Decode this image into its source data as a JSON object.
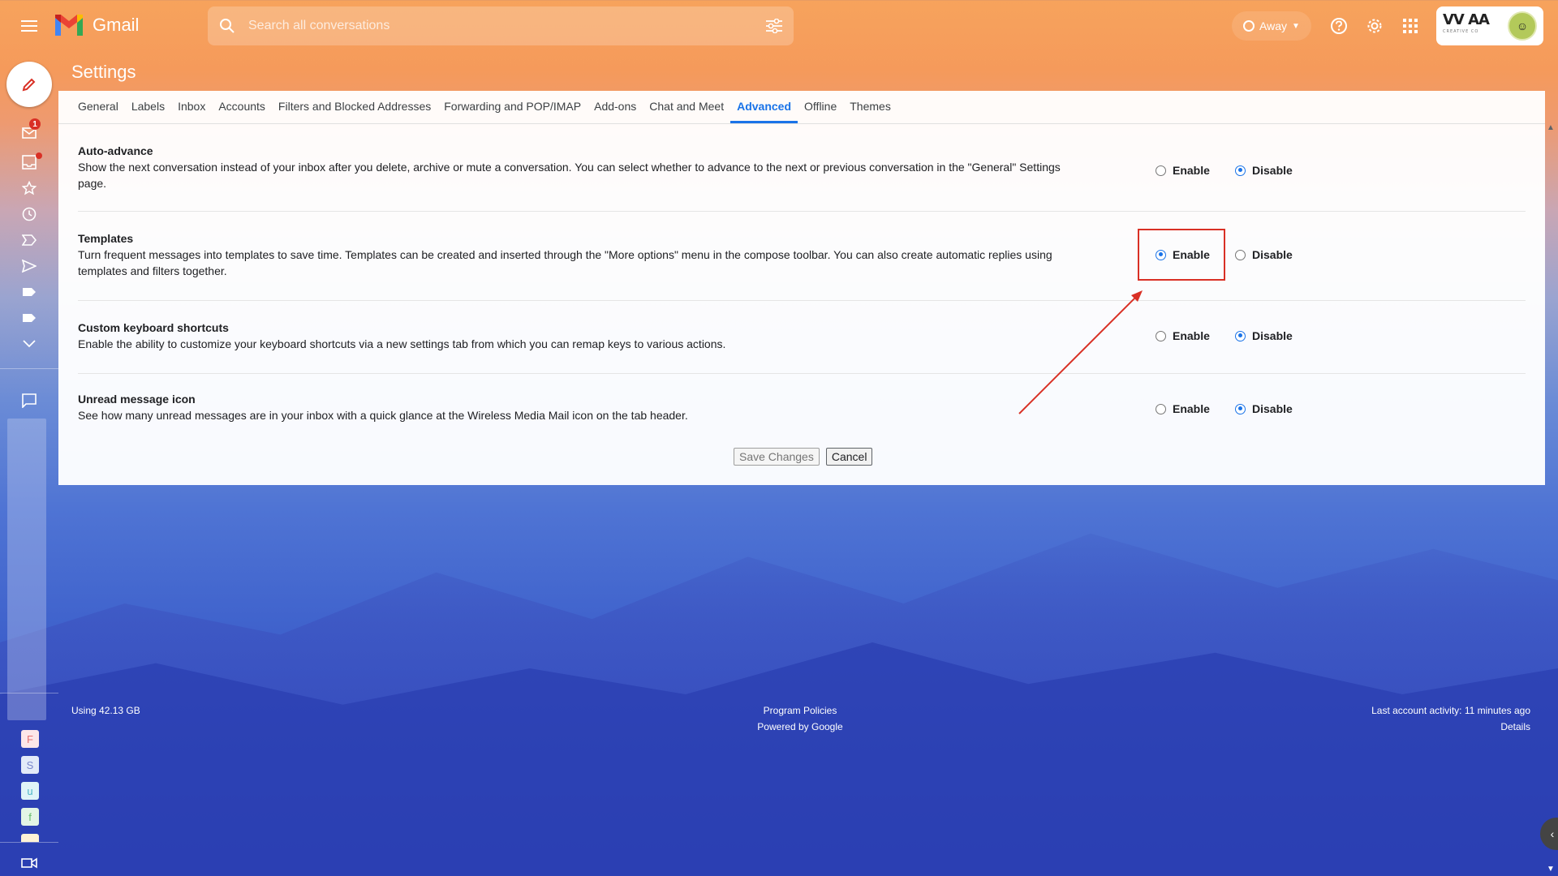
{
  "app": {
    "name": "Gmail"
  },
  "search": {
    "placeholder": "Search all conversations"
  },
  "status": {
    "label": "Away"
  },
  "account": {
    "brand_top": "VV AA",
    "brand_sub": "CREATIVE CO"
  },
  "rail": {
    "inbox_badge": "1",
    "chat_tiles": [
      {
        "letter": "F",
        "bg": "#fde7e9",
        "fg": "#e57373"
      },
      {
        "letter": "S",
        "bg": "#e3eaf8",
        "fg": "#7986cb"
      },
      {
        "letter": "u",
        "bg": "#e0f4f7",
        "fg": "#4db6c8"
      },
      {
        "letter": "f",
        "bg": "#e3f5e5",
        "fg": "#66bb6a"
      }
    ]
  },
  "page": {
    "title": "Settings"
  },
  "tabs": [
    {
      "label": "General"
    },
    {
      "label": "Labels"
    },
    {
      "label": "Inbox"
    },
    {
      "label": "Accounts"
    },
    {
      "label": "Filters and Blocked Addresses"
    },
    {
      "label": "Forwarding and POP/IMAP"
    },
    {
      "label": "Add-ons"
    },
    {
      "label": "Chat and Meet"
    },
    {
      "label": "Advanced",
      "active": true
    },
    {
      "label": "Offline"
    },
    {
      "label": "Themes"
    }
  ],
  "settings": [
    {
      "title": "Auto-advance",
      "description": "Show the next conversation instead of your inbox after you delete, archive or mute a conversation. You can select whether to advance to the next or previous conversation in the \"General\" Settings page.",
      "enable_label": "Enable",
      "disable_label": "Disable",
      "selected": "disable"
    },
    {
      "title": "Templates",
      "description": "Turn frequent messages into templates to save time. Templates can be created and inserted through the \"More options\" menu in the compose toolbar. You can also create automatic replies using templates and filters together.",
      "enable_label": "Enable",
      "disable_label": "Disable",
      "selected": "enable"
    },
    {
      "title": "Custom keyboard shortcuts",
      "description": "Enable the ability to customize your keyboard shortcuts via a new settings tab from which you can remap keys to various actions.",
      "enable_label": "Enable",
      "disable_label": "Disable",
      "selected": "disable"
    },
    {
      "title": "Unread message icon",
      "description": "See how many unread messages are in your inbox with a quick glance at the Wireless Media Mail icon on the tab header.",
      "enable_label": "Enable",
      "disable_label": "Disable",
      "selected": "disable"
    }
  ],
  "buttons": {
    "save": "Save Changes",
    "cancel": "Cancel"
  },
  "footer": {
    "storage": "Using 42.13 GB",
    "program_policies": "Program Policies",
    "powered_by": "Powered by Google",
    "last_activity": "Last account activity: 11 minutes ago",
    "details": "Details"
  },
  "colors": {
    "accent": "#1a73e8",
    "highlight": "#d93025"
  }
}
